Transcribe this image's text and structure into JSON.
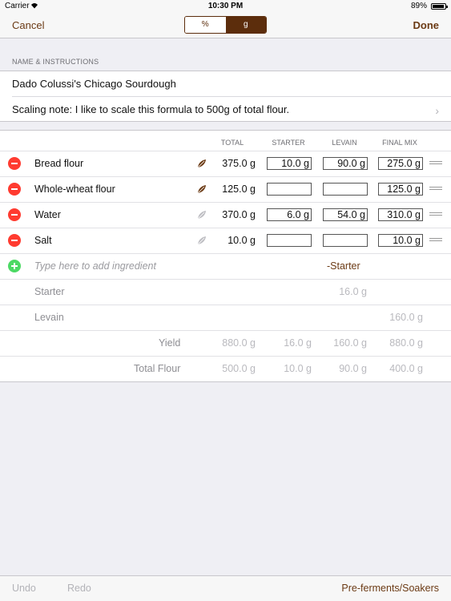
{
  "status": {
    "carrier": "Carrier",
    "time": "10:30 PM",
    "battery": "89%"
  },
  "nav": {
    "cancel": "Cancel",
    "done": "Done",
    "segments": [
      "%",
      "g"
    ],
    "selected": "g"
  },
  "form": {
    "section_header": "NAME & INSTRUCTIONS",
    "name": "Dado Colussi's Chicago Sourdough",
    "note": "Scaling note: I like to scale this formula to 500g of total flour."
  },
  "table": {
    "headers": {
      "total": "TOTAL",
      "starter": "STARTER",
      "levain": "LEVAIN",
      "final_mix": "FINAL MIX"
    },
    "ingredients": [
      {
        "name": "Bread flour",
        "total": "375.0 g",
        "starter": "10.0 g",
        "levain": "90.0 g",
        "final_mix": "275.0 g",
        "flour": true
      },
      {
        "name": "Whole-wheat flour",
        "total": "125.0 g",
        "starter": "",
        "levain": "",
        "final_mix": "125.0 g",
        "flour": true
      },
      {
        "name": "Water",
        "total": "370.0 g",
        "starter": "6.0 g",
        "levain": "54.0 g",
        "final_mix": "310.0 g",
        "flour": false
      },
      {
        "name": "Salt",
        "total": "10.0 g",
        "starter": "",
        "levain": "",
        "final_mix": "10.0 g",
        "flour": false
      }
    ],
    "add_placeholder": "Type here to add ingredient",
    "minus_starter": "-Starter",
    "starter_row": {
      "label": "Starter",
      "levain": "16.0 g"
    },
    "levain_row": {
      "label": "Levain",
      "final_mix": "160.0 g"
    },
    "yield": {
      "label": "Yield",
      "total": "880.0 g",
      "starter": "16.0 g",
      "levain": "160.0 g",
      "final_mix": "880.0 g"
    },
    "total_flour": {
      "label": "Total Flour",
      "total": "500.0 g",
      "starter": "10.0 g",
      "levain": "90.0 g",
      "final_mix": "400.0 g"
    }
  },
  "toolbar": {
    "undo": "Undo",
    "redo": "Redo",
    "preferments": "Pre-ferments/Soakers"
  },
  "colors": {
    "accent": "#5c2d0c",
    "delete": "#ff3b30",
    "add": "#4cd964",
    "flour_leaf": "#6b3a14",
    "nonflour_leaf": "#bdbdc2"
  }
}
